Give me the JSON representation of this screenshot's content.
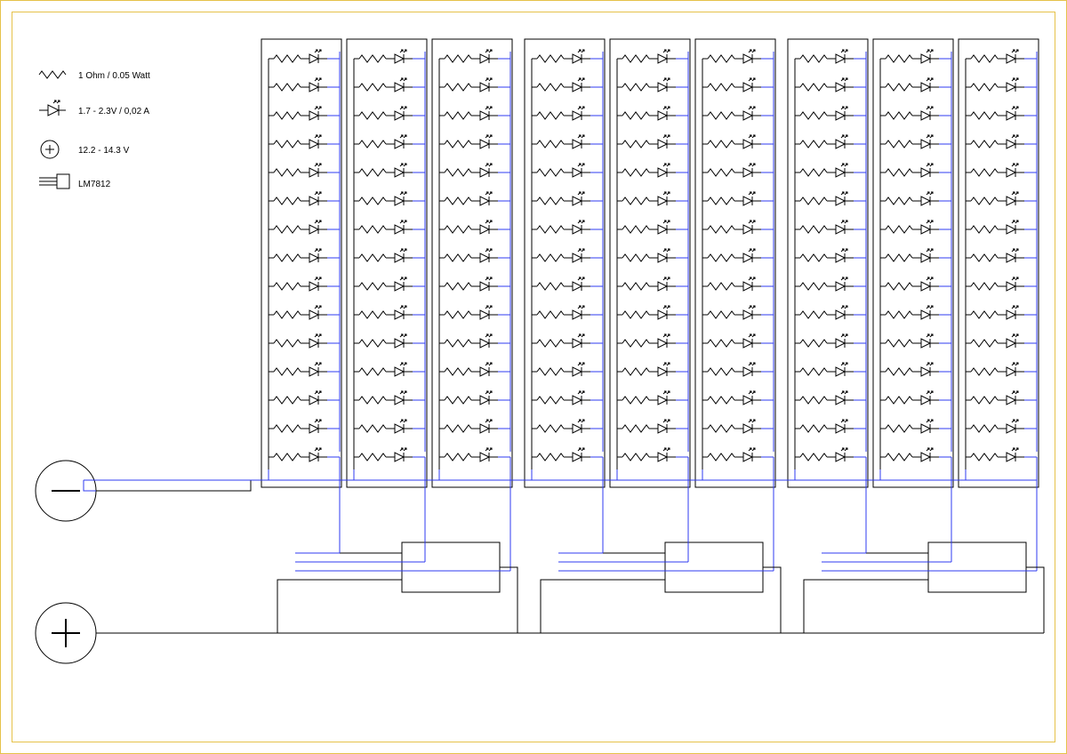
{
  "legend": {
    "resistor": "1 Ohm / 0.05 Watt",
    "led": "1.7 - 2.3V / 0,02 A",
    "source": "12.2 - 14.3 V",
    "regulator": "LM7812"
  },
  "schematic": {
    "rows_per_column": 15,
    "columns_per_group": 3,
    "groups": 3,
    "regulators": 3,
    "total_columns": 9,
    "cell": "resistor + LED in series",
    "colors": {
      "bus": "#2f3bf2",
      "line": "#000000"
    }
  }
}
